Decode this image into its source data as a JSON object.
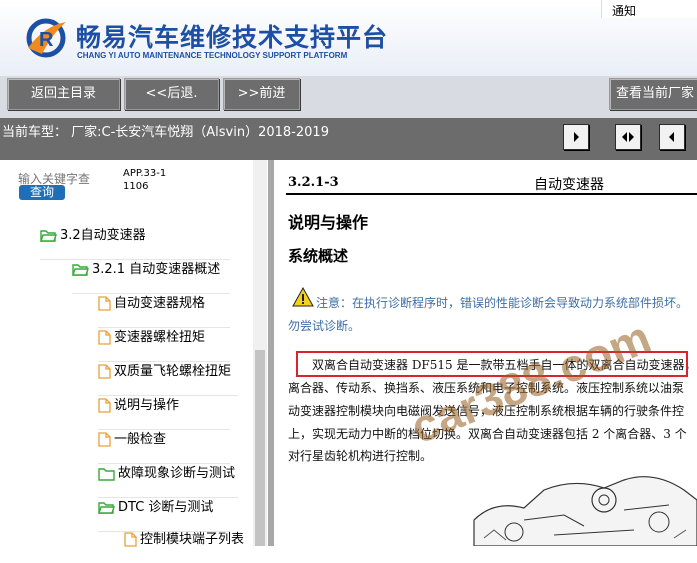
{
  "header": {
    "title": "畅易汽车维修技术支持平台",
    "subtitle": "CHANG YI AUTO MAINTENANCE TECHNOLOGY SUPPORT PLATFORM",
    "notice": "通知"
  },
  "toolbar": {
    "home": "返回主目录",
    "back": "<<后退.",
    "forward": ">>前进",
    "view_current": "查看当前厂家"
  },
  "vehicle": {
    "current": "当前车型：  厂家:C-长安汽车悦翔（Alsvin）2018-2019"
  },
  "search": {
    "placeholder": "输入关键字查",
    "button": "查询",
    "app_version": "APP.33-11106"
  },
  "tree": [
    {
      "label": "3.2自动变速器",
      "icon": "folder-open-icon"
    },
    {
      "label": "3.2.1 自动变速器概述",
      "icon": "folder-open-icon"
    },
    {
      "label": "自动变速器规格",
      "icon": "document-icon"
    },
    {
      "label": "变速器螺栓扭矩",
      "icon": "document-icon"
    },
    {
      "label": "双质量飞轮螺栓扭矩",
      "icon": "document-icon"
    },
    {
      "label": "说明与操作",
      "icon": "document-icon"
    },
    {
      "label": "一般检查",
      "icon": "document-icon"
    },
    {
      "label": "故障现象诊断与测试",
      "icon": "folder-icon"
    },
    {
      "label": "DTC 诊断与测试",
      "icon": "folder-open-icon"
    },
    {
      "label": "控制模块端子列表",
      "icon": "document-icon"
    }
  ],
  "document": {
    "section_code": "3.2.1-3",
    "section_title": "自动变速器",
    "heading": "说明与操作",
    "subheading": "系统概述",
    "warning_line1": "注意：在执行诊断程序时，错误的性能诊断会导致动力系统部件损坏。",
    "warning_line2": "勿尝试诊断。",
    "paragraph": [
      "双离合自动变速器 DF515 是一款带五档手自一体的双离合自动变速器，",
      "离合器、传动系、换挡系、液压系统和电子控制系统。液压控制系统以油泵",
      "动变速器控制模块向电磁阀发送信号，液压控制系统根据车辆的行驶条件控",
      "上，实现无动力中断的档位切换。双离合自动变速器包括 2 个离合器、3 个",
      "对行星齿轮机构进行控制。"
    ],
    "watermark": "car388.com"
  },
  "colors": {
    "brand_blue": "#1d4fa5",
    "toolbar_button": "#6d6d6d",
    "highlight_red": "#d8242e",
    "folder_green": "#3aa93a",
    "doc_icon_orange": "#e9a13a"
  }
}
